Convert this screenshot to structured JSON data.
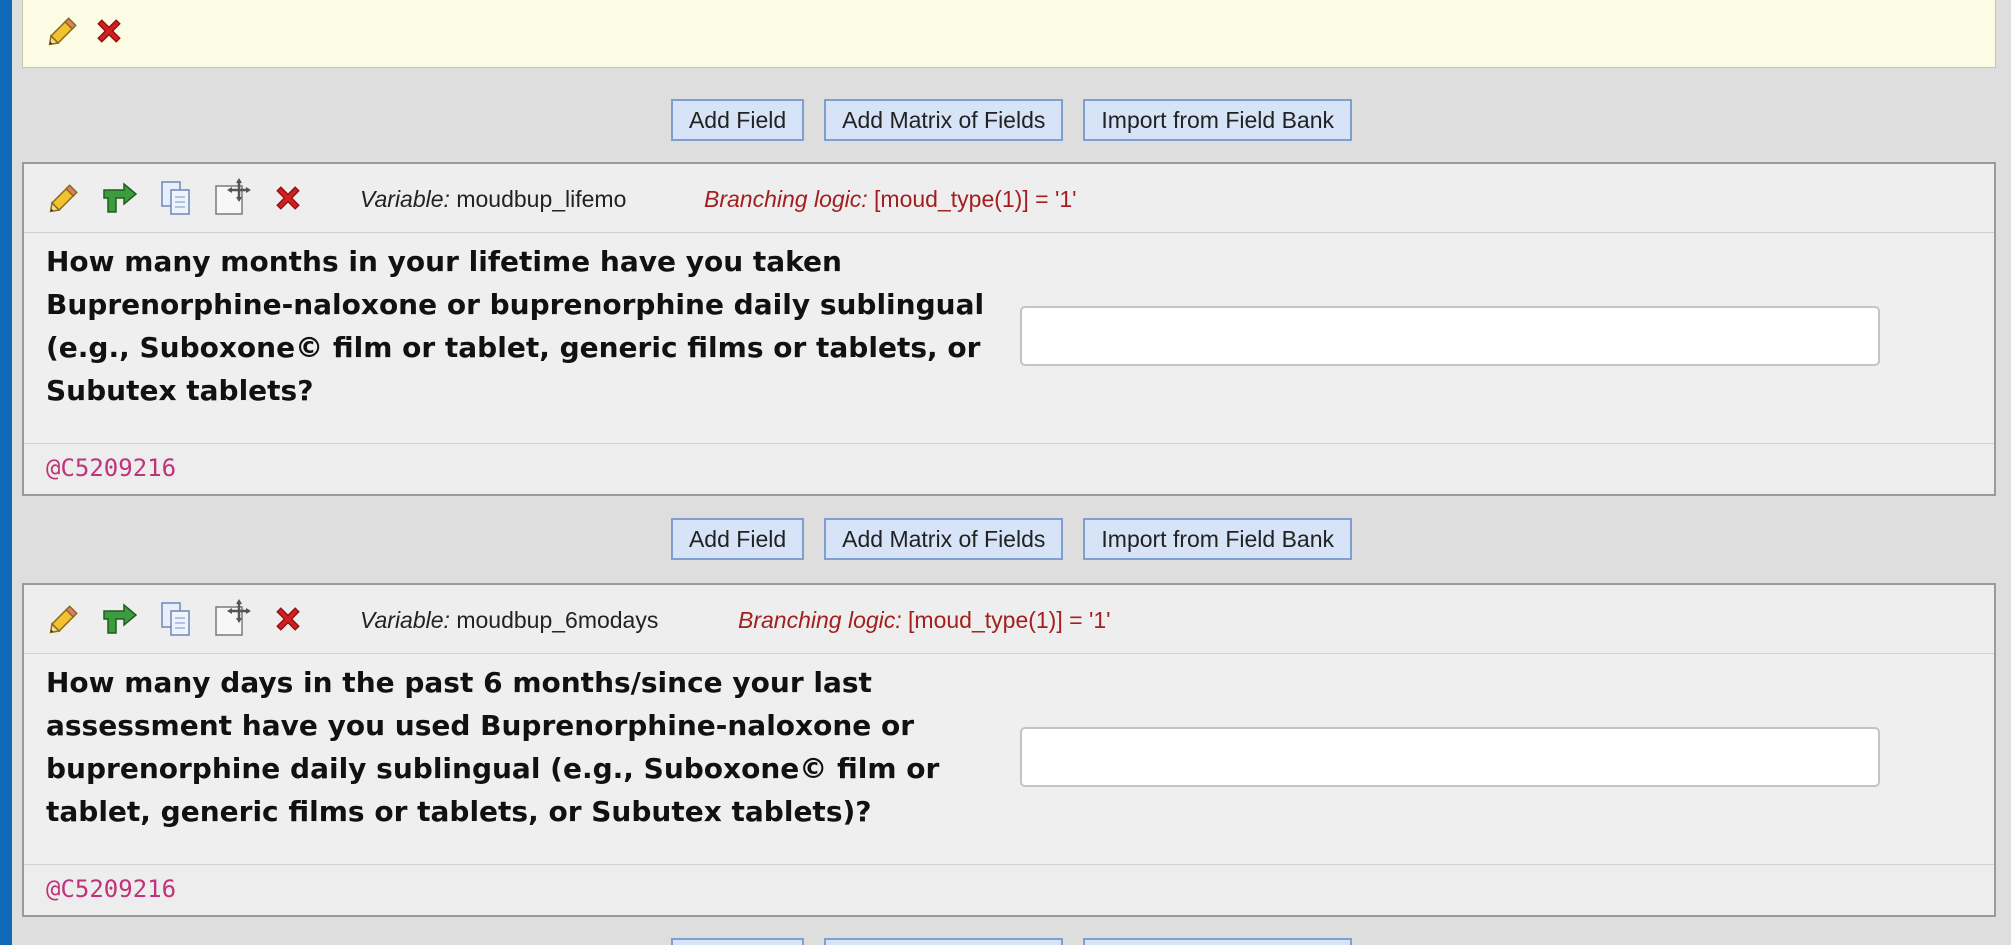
{
  "buttons": {
    "add_field": "Add Field",
    "add_matrix": "Add Matrix of Fields",
    "import_bank": "Import from Field Bank"
  },
  "labels": {
    "variable": "Variable:",
    "branching": "Branching logic:"
  },
  "fields": [
    {
      "variable": "moudbup_lifemo",
      "branching_logic": "[moud_type(1)] = '1'",
      "question": "How many months in your lifetime have you taken Buprenorphine-naloxone or buprenorphine daily sublingual (e.g., Suboxone© film or tablet, generic films or tablets, or Subutex tablets?",
      "answer_value": "",
      "annotation": "@C5209216"
    },
    {
      "variable": "moudbup_6modays",
      "branching_logic": "[moud_type(1)] = '1'",
      "question": "How many days in the past 6 months/since your last assessment have you used Buprenorphine-naloxone or buprenorphine daily sublingual (e.g., Suboxone© film or tablet, generic films or tablets, or Subutex tablets)?",
      "answer_value": "",
      "annotation": "@C5209216"
    }
  ],
  "icons": {
    "edit": "pencil-icon",
    "branching": "branching-logic-icon",
    "copy": "copy-icon",
    "move": "move-icon",
    "delete": "delete-icon"
  },
  "colors": {
    "frame_bg": "#0d6ab8",
    "branching_text": "#a31f1f",
    "annotation_text": "#c0337a",
    "button_bg": "#d7e3f7",
    "button_border": "#7f9fd0"
  }
}
